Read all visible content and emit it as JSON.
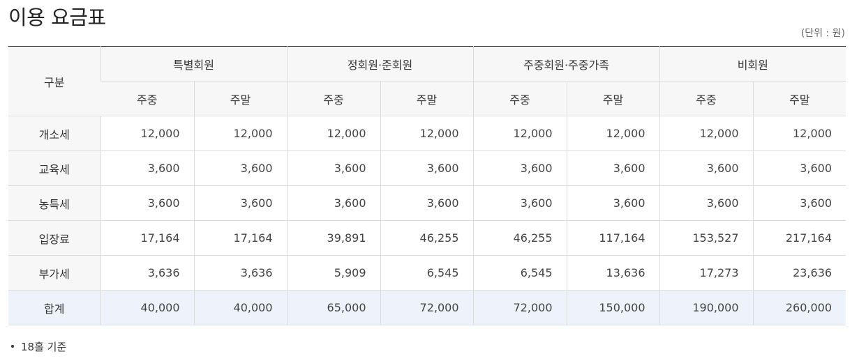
{
  "page": {
    "title": "이용 요금표",
    "unit_note": "(단위 : 원)",
    "footnote": "18홀 기준"
  },
  "table": {
    "corner_header": "구분",
    "groups": [
      "특별회원",
      "정회원·준회원",
      "주중회원·주중가족",
      "비회원"
    ],
    "sub_headers": [
      "주중",
      "주말",
      "주중",
      "주말",
      "주중",
      "주말",
      "주중",
      "주말"
    ],
    "rows": [
      {
        "label": "개소세",
        "values": [
          "12,000",
          "12,000",
          "12,000",
          "12,000",
          "12,000",
          "12,000",
          "12,000",
          "12,000"
        ]
      },
      {
        "label": "교육세",
        "values": [
          "3,600",
          "3,600",
          "3,600",
          "3,600",
          "3,600",
          "3,600",
          "3,600",
          "3,600"
        ]
      },
      {
        "label": "농특세",
        "values": [
          "3,600",
          "3,600",
          "3,600",
          "3,600",
          "3,600",
          "3,600",
          "3,600",
          "3,600"
        ]
      },
      {
        "label": "입장료",
        "values": [
          "17,164",
          "17,164",
          "39,891",
          "46,255",
          "46,255",
          "117,164",
          "153,527",
          "217,164"
        ]
      },
      {
        "label": "부가세",
        "values": [
          "3,636",
          "3,636",
          "5,909",
          "6,545",
          "6,545",
          "13,636",
          "17,273",
          "23,636"
        ]
      },
      {
        "label": "합계",
        "values": [
          "40,000",
          "40,000",
          "65,000",
          "72,000",
          "72,000",
          "150,000",
          "190,000",
          "260,000"
        ]
      }
    ]
  },
  "colors": {
    "header_bg": "#f7f7f7",
    "total_row_bg": "#eef2fb",
    "top_border": "#333333",
    "cell_border": "#dcdcdc"
  }
}
